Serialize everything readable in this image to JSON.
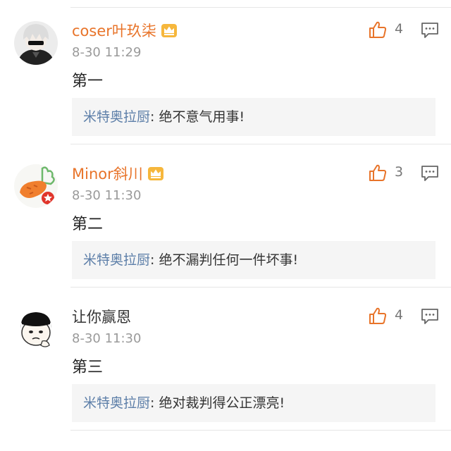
{
  "comments": [
    {
      "username": "coser叶玖柒",
      "vip": true,
      "avatar_icon": "white-haired-character-avatar-icon",
      "time": "8-30 11:29",
      "likes": "4",
      "content": "第一",
      "quote": {
        "name": "米特奥拉厨",
        "colon": ": ",
        "text": "绝不意气用事!"
      }
    },
    {
      "username": "Minor斜川",
      "vip": true,
      "avatar_icon": "carrot-avatar-icon",
      "time": "8-30 11:30",
      "likes": "3",
      "content": "第二",
      "quote": {
        "name": "米特奥拉厨",
        "colon": ": ",
        "text": "绝不漏判任何一件坏事!"
      }
    },
    {
      "username": "让你赢恩",
      "vip": false,
      "avatar_icon": "cartoon-face-avatar-icon",
      "time": "8-30 11:30",
      "likes": "4",
      "content": "第三",
      "quote": {
        "name": "米特奥拉厨",
        "colon": ": ",
        "text": "绝对裁判得公正漂亮!"
      }
    }
  ],
  "colors": {
    "vip_name": "#e8742a",
    "like_icon": "#e8742a",
    "quote_name": "#5c7ea8",
    "quote_bg": "#f5f5f5",
    "timestamp": "#9a9a9a"
  },
  "icons": {
    "like": "thumbs-up-icon",
    "reply": "comment-icon",
    "vip": "crown-badge-icon"
  }
}
